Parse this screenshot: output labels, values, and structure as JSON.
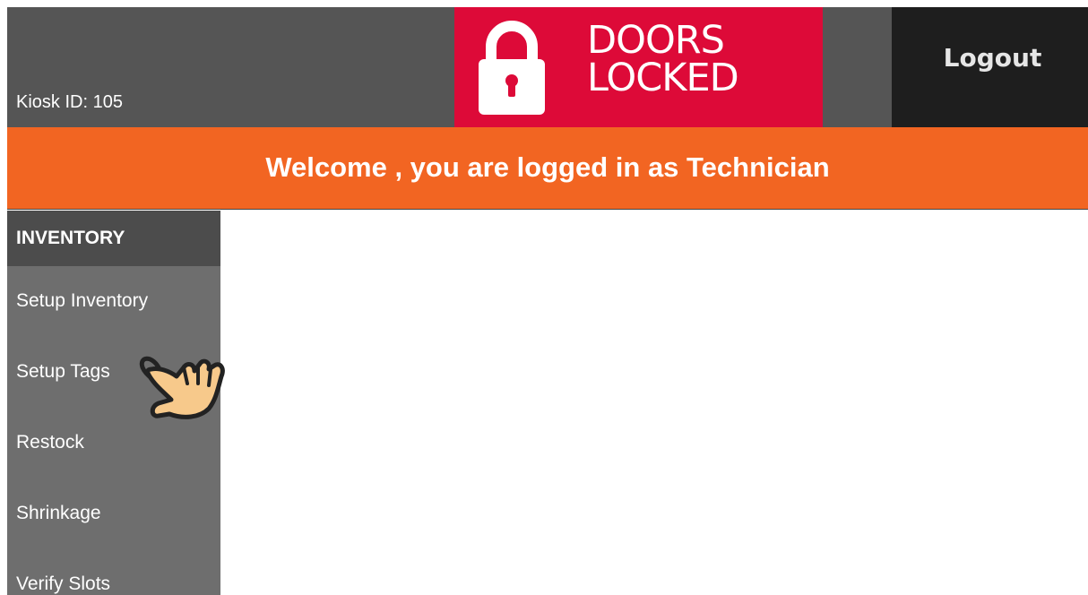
{
  "header": {
    "kiosk_id": "Kiosk ID: 105",
    "lock_status": {
      "icon": "padlock-icon",
      "line1": "DOORS",
      "line2": "LOCKED",
      "color": "#dd0a38"
    },
    "logout_label": "Logout"
  },
  "banner": {
    "welcome_text": "Welcome , you are logged in as Technician",
    "color": "#f26522"
  },
  "sidebar": {
    "section_title": "INVENTORY",
    "items": [
      {
        "label": "Setup Inventory"
      },
      {
        "label": "Setup Tags"
      },
      {
        "label": "Restock"
      },
      {
        "label": "Shrinkage"
      },
      {
        "label": "Verify Slots"
      }
    ]
  },
  "cursor": {
    "icon": "hand-pointer-icon"
  }
}
